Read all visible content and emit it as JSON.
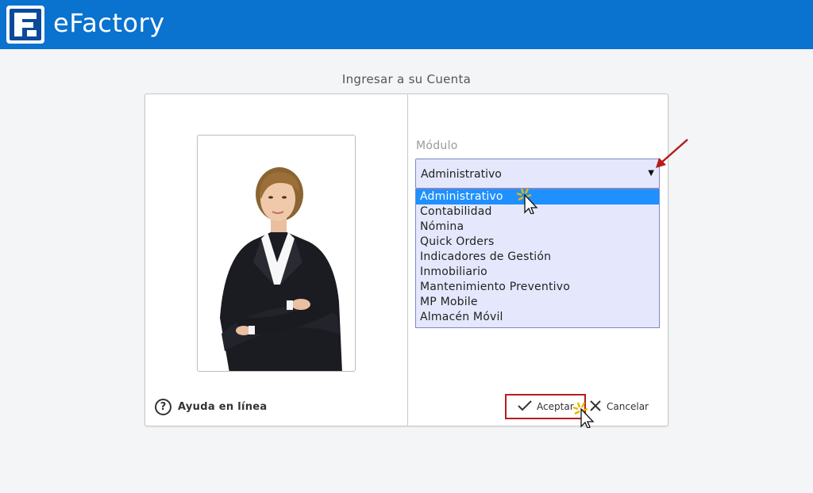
{
  "app": {
    "title": "eFactory"
  },
  "login": {
    "title": "Ingresar a su Cuenta"
  },
  "help": {
    "label": "Ayuda en línea",
    "icon": "question-circle-icon"
  },
  "module": {
    "label": "Módulo",
    "selected": "Administrativo",
    "options": [
      "Administrativo",
      "Contabilidad",
      "Nómina",
      "Quick Orders",
      "Indicadores de Gestión",
      "Inmobiliario",
      "Mantenimiento Preventivo",
      "MP Mobile",
      "Almacén Móvil"
    ],
    "highlighted_index": 0
  },
  "actions": {
    "accept_label": "Aceptar",
    "cancel_label": "Cancelar"
  },
  "colors": {
    "header": "#0a72cf",
    "selection": "#1e90ff",
    "list_bg": "#e5e8fc",
    "annotation": "#b71c1c"
  }
}
